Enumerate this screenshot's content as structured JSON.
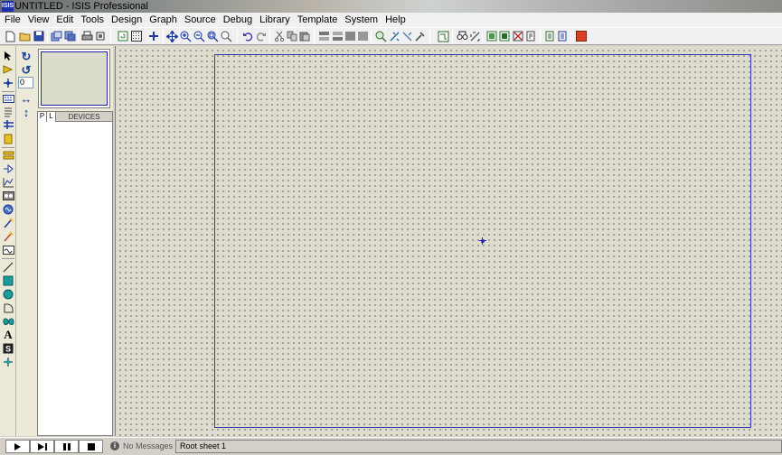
{
  "window": {
    "app_icon": "ISIS",
    "title": "UNTITLED - ISIS Professional"
  },
  "menu": [
    "File",
    "View",
    "Edit",
    "Tools",
    "Design",
    "Graph",
    "Source",
    "Debug",
    "Library",
    "Template",
    "System",
    "Help"
  ],
  "toolbar": {
    "icons": [
      "new-file-icon",
      "open-folder-icon",
      "save-icon",
      "import-section-icon",
      "export-section-icon",
      "print-icon",
      "print-area-icon",
      "refresh-icon",
      "grid-icon",
      "origin-icon",
      "pan-icon",
      "zoom-in-icon",
      "zoom-out-icon",
      "zoom-all-icon",
      "zoom-area-icon",
      "undo-icon",
      "redo-icon",
      "cut-icon",
      "copy-icon",
      "paste-icon",
      "block-copy-icon",
      "block-move-icon",
      "block-rotate-icon",
      "block-delete-icon",
      "pick-device-icon",
      "make-device-icon",
      "packaging-tool-icon",
      "decompose-icon",
      "wire-autorouter-icon",
      "search-tag-icon",
      "property-assignment-icon",
      "new-sheet-icon",
      "remove-sheet-icon",
      "exit-to-parent-icon",
      "bill-of-materials-icon",
      "electrical-rule-check-icon",
      "netlist-to-ares-icon"
    ]
  },
  "left_tools": [
    "selection-mode-icon",
    "component-mode-icon",
    "junction-dot-icon",
    "wire-label-icon",
    "text-script-icon",
    "buses-icon",
    "subcircuit-icon",
    "terminals-icon",
    "device-pins-icon",
    "graph-icon",
    "tape-recorder-icon",
    "generator-icon",
    "voltage-probe-icon",
    "current-probe-icon",
    "virtual-instruments-icon",
    "line-icon",
    "box-icon",
    "circle-icon",
    "arc-icon",
    "closed-path-icon",
    "text-icon",
    "symbol-icon",
    "marker-icon"
  ],
  "rotation": {
    "rotate_cw_icon": "rotate-clockwise-icon",
    "rotate_ccw_icon": "rotate-anticlockwise-icon",
    "angle_value": "0",
    "mirror_x_icon": "mirror-horizontal-icon",
    "mirror_y_icon": "mirror-vertical-icon"
  },
  "devices_panel": {
    "pick_button": "P",
    "library_button": "L",
    "header": "DEVICES"
  },
  "statusbar": {
    "messages": "No Messages",
    "sheet": "Root sheet 1"
  },
  "colors": {
    "canvas_bg": "#dedccd",
    "sheet_border": "#3a3ab0",
    "origin_marker": "#2525c0"
  }
}
